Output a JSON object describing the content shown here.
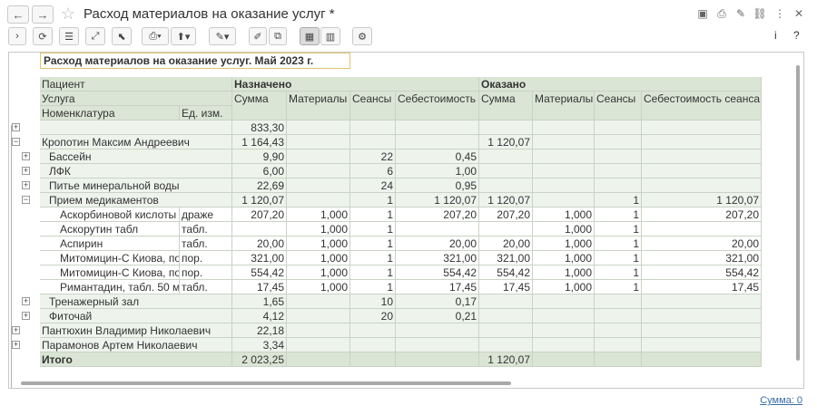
{
  "window": {
    "title": "Расход материалов на оказание услуг *",
    "back_icon": "←",
    "forward_icon": "→",
    "star_icon": "☆"
  },
  "toolbar": {
    "info_label": "i",
    "help_label": "?"
  },
  "report": {
    "title": "Расход материалов на оказание услуг. Май 2023 г.",
    "header": {
      "patient": "Пациент",
      "service": "Услуга",
      "nomenclature": "Номенклатура",
      "unit": "Ед. изм.",
      "assigned": "Назначено",
      "done": "Оказано",
      "sum": "Сумма",
      "materials": "Материалы",
      "sessions": "Сеансы",
      "cost": "Себестоимость",
      "sum2": "Сумма",
      "materials2": "Материалы",
      "sessions2": "Сеансы",
      "cost_session": "Себестоимость сеанса"
    },
    "rows": [
      {
        "label": "",
        "unit": "",
        "c1": "833,30",
        "c2": "",
        "c3": "",
        "c4": "",
        "c5": "",
        "c6": "",
        "c7": "",
        "c8": ""
      },
      {
        "label": "Кропотин Максим Андреевич",
        "unit": "",
        "c1": "1 164,43",
        "c2": "",
        "c3": "",
        "c4": "",
        "c5": "1 120,07",
        "c6": "",
        "c7": "",
        "c8": ""
      },
      {
        "label": "Бассейн",
        "unit": "",
        "c1": "9,90",
        "c2": "",
        "c3": "22",
        "c4": "0,45",
        "c5": "",
        "c6": "",
        "c7": "",
        "c8": ""
      },
      {
        "label": "ЛФК",
        "unit": "",
        "c1": "6,00",
        "c2": "",
        "c3": "6",
        "c4": "1,00",
        "c5": "",
        "c6": "",
        "c7": "",
        "c8": ""
      },
      {
        "label": "Питье минеральной воды",
        "unit": "",
        "c1": "22,69",
        "c2": "",
        "c3": "24",
        "c4": "0,95",
        "c5": "",
        "c6": "",
        "c7": "",
        "c8": ""
      },
      {
        "label": "Прием медикаментов",
        "unit": "",
        "c1": "1 120,07",
        "c2": "",
        "c3": "1",
        "c4": "1 120,07",
        "c5": "1 120,07",
        "c6": "",
        "c7": "1",
        "c8": "1 120,07"
      },
      {
        "label": "Аскорбиновой кислоты",
        "unit": "драже",
        "c1": "207,20",
        "c2": "1,000",
        "c3": "1",
        "c4": "207,20",
        "c5": "207,20",
        "c6": "1,000",
        "c7": "1",
        "c8": "207,20"
      },
      {
        "label": "Аскорутин табл",
        "unit": "табл.",
        "c1": "",
        "c2": "1,000",
        "c3": "1",
        "c4": "",
        "c5": "",
        "c6": "1,000",
        "c7": "1",
        "c8": ""
      },
      {
        "label": "Аспирин",
        "unit": "табл.",
        "c1": "20,00",
        "c2": "1,000",
        "c3": "1",
        "c4": "20,00",
        "c5": "20,00",
        "c6": "1,000",
        "c7": "1",
        "c8": "20,00"
      },
      {
        "label": "Митомицин-С Киова, по",
        "unit": "пор.",
        "c1": "321,00",
        "c2": "1,000",
        "c3": "1",
        "c4": "321,00",
        "c5": "321,00",
        "c6": "1,000",
        "c7": "1",
        "c8": "321,00"
      },
      {
        "label": "Митомицин-С Киова, по",
        "unit": "пор.",
        "c1": "554,42",
        "c2": "1,000",
        "c3": "1",
        "c4": "554,42",
        "c5": "554,42",
        "c6": "1,000",
        "c7": "1",
        "c8": "554,42"
      },
      {
        "label": "Римантадин, табл. 50 м",
        "unit": "табл.",
        "c1": "17,45",
        "c2": "1,000",
        "c3": "1",
        "c4": "17,45",
        "c5": "17,45",
        "c6": "1,000",
        "c7": "1",
        "c8": "17,45"
      },
      {
        "label": "Тренажерный зал",
        "unit": "",
        "c1": "1,65",
        "c2": "",
        "c3": "10",
        "c4": "0,17",
        "c5": "",
        "c6": "",
        "c7": "",
        "c8": ""
      },
      {
        "label": "Фиточай",
        "unit": "",
        "c1": "4,12",
        "c2": "",
        "c3": "20",
        "c4": "0,21",
        "c5": "",
        "c6": "",
        "c7": "",
        "c8": ""
      },
      {
        "label": "Пантюхин Владимир Николаевич",
        "unit": "",
        "c1": "22,18",
        "c2": "",
        "c3": "",
        "c4": "",
        "c5": "",
        "c6": "",
        "c7": "",
        "c8": ""
      },
      {
        "label": "Парамонов Артем Николаевич",
        "unit": "",
        "c1": "3,34",
        "c2": "",
        "c3": "",
        "c4": "",
        "c5": "",
        "c6": "",
        "c7": "",
        "c8": ""
      }
    ],
    "total": {
      "label": "Итого",
      "c1": "2 023,25",
      "c5": "1 120,07"
    }
  },
  "status": {
    "sum_label": "Сумма: 0"
  },
  "colors": {
    "header_bg": "#dbe5d6",
    "row_bg": "#eef3ec",
    "title_border": "#e2c46e",
    "link": "#3a6ea5"
  }
}
